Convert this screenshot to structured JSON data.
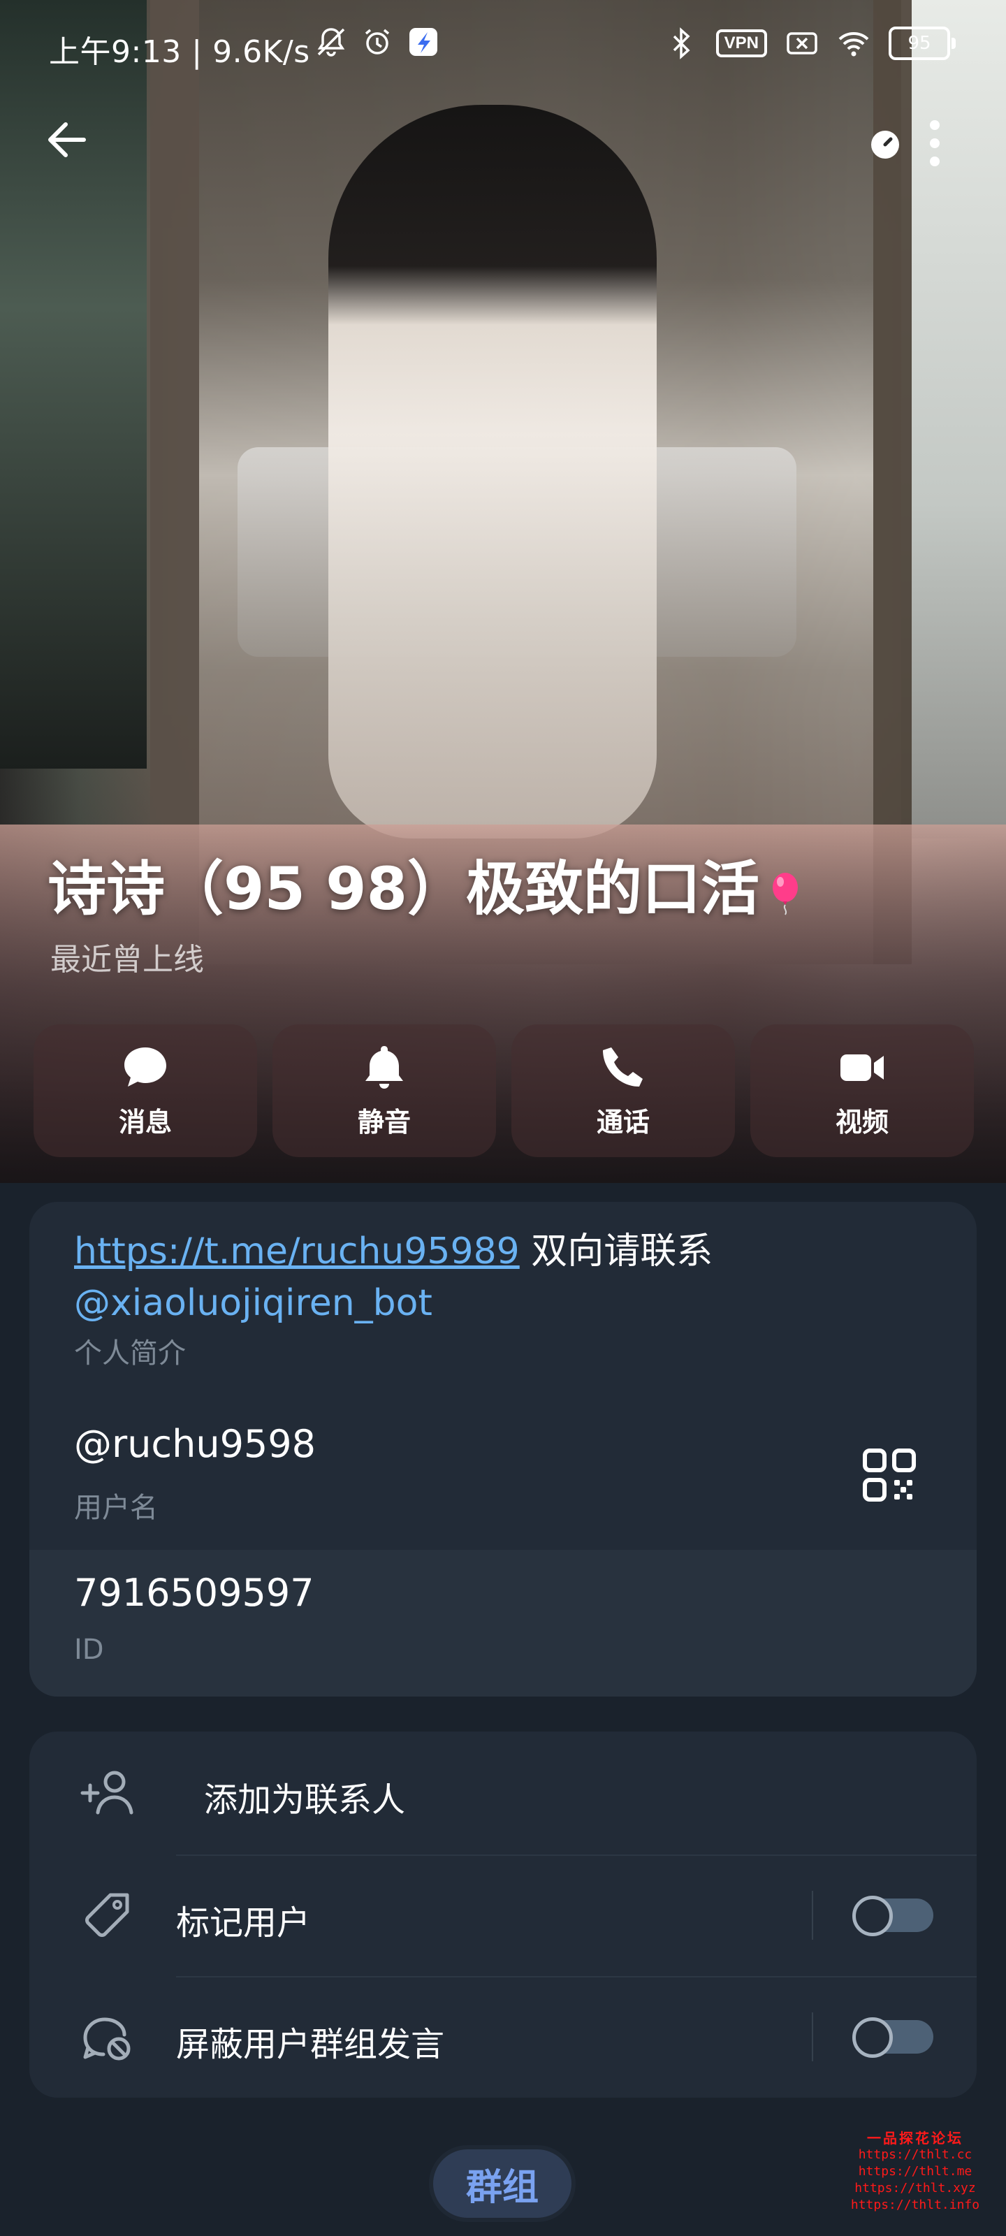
{
  "status_bar": {
    "time": "上午9:13 | 9.6K/s",
    "vpn": "VPN",
    "battery": "95"
  },
  "profile": {
    "name": "诗诗（95 98）极致的口活",
    "status": "最近曾上线"
  },
  "actions": [
    {
      "label": "消息",
      "icon": "chat-bubble-icon"
    },
    {
      "label": "静音",
      "icon": "bell-icon"
    },
    {
      "label": "通话",
      "icon": "phone-icon"
    },
    {
      "label": "视频",
      "icon": "video-camera-icon"
    }
  ],
  "info": {
    "bio_link": "https://t.me/ruchu95989",
    "bio_text": " 双向请联系",
    "bio_mention": "@xiaoluojiqiren_bot",
    "bio_label": "个人简介",
    "username": "@ruchu9598",
    "username_label": "用户名",
    "id_value": "7916509597",
    "id_label": "ID"
  },
  "options": {
    "add_contact": "添加为联系人",
    "tag_user": "标记用户",
    "tag_user_enabled": false,
    "block_group_speech": "屏蔽用户群组发言",
    "block_group_speech_enabled": false
  },
  "bottom": {
    "group_button": "群组"
  },
  "watermark": {
    "title": "一品探花论坛",
    "lines": [
      "https://thlt.cc",
      "https://thlt.me",
      "https://thlt.xyz",
      "https://thlt.info"
    ]
  },
  "colors": {
    "accent_link": "#6ab2f2",
    "card_bg": "#222b37",
    "page_bg": "#1a222c",
    "watermark": "#ff1a1a"
  }
}
